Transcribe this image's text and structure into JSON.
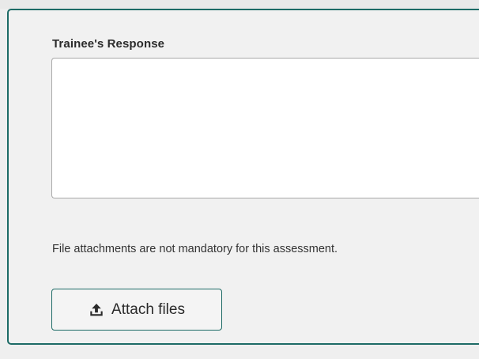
{
  "form": {
    "response_label": "Trainee's Response",
    "response_value": "",
    "attachment_note": "File attachments are not mandatory for this assessment.",
    "attach_button_label": "Attach files",
    "attach_icon": "upload-icon"
  },
  "colors": {
    "accent": "#1d6b66",
    "page_background": "#efefef",
    "input_background": "#ffffff",
    "input_border": "#a9a9a9",
    "text": "#2b2b2b"
  }
}
